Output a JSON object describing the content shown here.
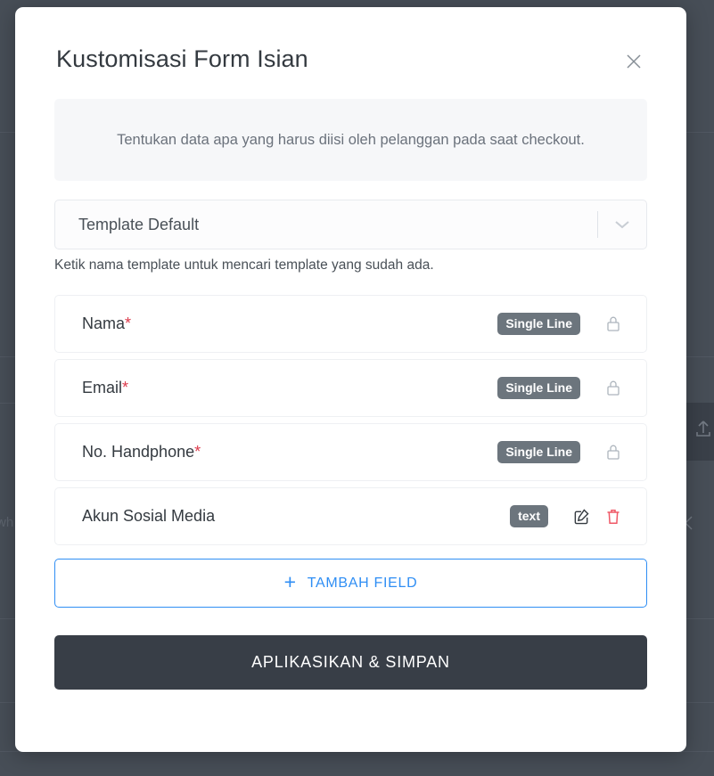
{
  "background": {
    "upload_icon": "upload-icon",
    "back_chevron_icon": "chevron-left-icon",
    "fragment_text": "wh"
  },
  "modal": {
    "title": "Kustomisasi Form Isian",
    "close_icon": "close-icon",
    "info_banner": {
      "text": "Tentukan data apa yang harus diisi oleh pelanggan pada saat checkout."
    },
    "template_select": {
      "value": "Template Default",
      "caret_icon": "chevron-down-icon",
      "hint": "Ketik nama template untuk mencari template yang sudah ada."
    },
    "fields": [
      {
        "label": "Nama",
        "required": "*",
        "badge": "Single Line",
        "actions": [
          "lock-icon"
        ]
      },
      {
        "label": "Email",
        "required": "*",
        "badge": "Single Line",
        "actions": [
          "lock-icon"
        ]
      },
      {
        "label": "No. Handphone",
        "required": "*",
        "badge": "Single Line",
        "actions": [
          "lock-icon"
        ]
      },
      {
        "label": "Akun Sosial Media",
        "required": "",
        "badge": "text",
        "actions": [
          "edit-icon",
          "trash-icon"
        ]
      }
    ],
    "add_field_button": {
      "label": "TAMBAH FIELD",
      "icon": "plus-icon"
    },
    "submit_button": {
      "label": "APLIKASIKAN & SIMPAN"
    }
  },
  "colors": {
    "accent_blue": "#2f8ef4",
    "badge_gray": "#6c757d",
    "danger_red": "#ef5866",
    "required_red": "#dc3a4b",
    "dark_button": "#383e47",
    "backdrop": "#474e57"
  }
}
